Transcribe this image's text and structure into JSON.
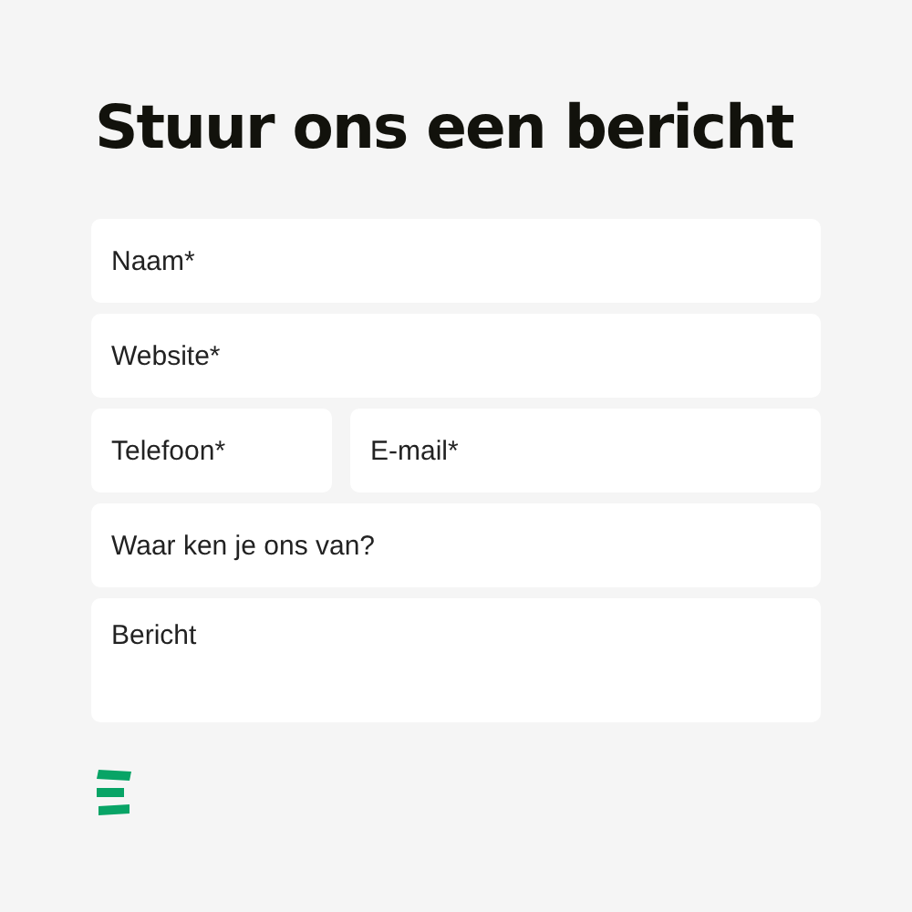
{
  "title": {
    "lead": "Stuur ons een",
    "highlight": "bericht"
  },
  "form_rows": [
    {
      "fields": [
        {
          "kind": "input",
          "placeholder": "Naam*"
        }
      ]
    },
    {
      "fields": [
        {
          "kind": "input",
          "placeholder": "Website*"
        }
      ]
    },
    {
      "fields": [
        {
          "kind": "input",
          "placeholder": "Telefoon*"
        },
        {
          "kind": "input",
          "placeholder": "E-mail*"
        }
      ]
    },
    {
      "fields": [
        {
          "kind": "input",
          "placeholder": "Waar ken je ons van?"
        }
      ]
    },
    {
      "fields": [
        {
          "kind": "textarea",
          "placeholder": "Bericht"
        }
      ]
    }
  ]
}
